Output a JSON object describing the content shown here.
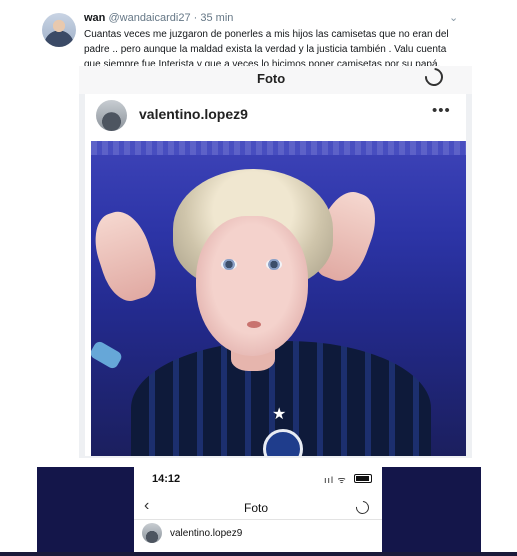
{
  "tweet": {
    "name": "wan",
    "handle": "@wandaicardi27",
    "separator": " · ",
    "time": "35 min",
    "caret": "⌄",
    "text": "Cuantas veces me juzgaron de ponerles a mis hijos las camisetas que no eran del padre .. pero aunque la maldad exista la verdad y la justicia también . Valu cuenta que siempre fue Interista y que a veces lo hicimos poner camisetas por su papá."
  },
  "screenshot_top": {
    "title": "Foto",
    "instagram": {
      "username": "valentino.lopez9",
      "more_icon": "•••"
    }
  },
  "screenshot_bottom": {
    "time": "14:12",
    "status_icons": "ııl ᯤ",
    "back_icon": "‹",
    "title": "Foto",
    "username": "valentino.lopez9"
  }
}
